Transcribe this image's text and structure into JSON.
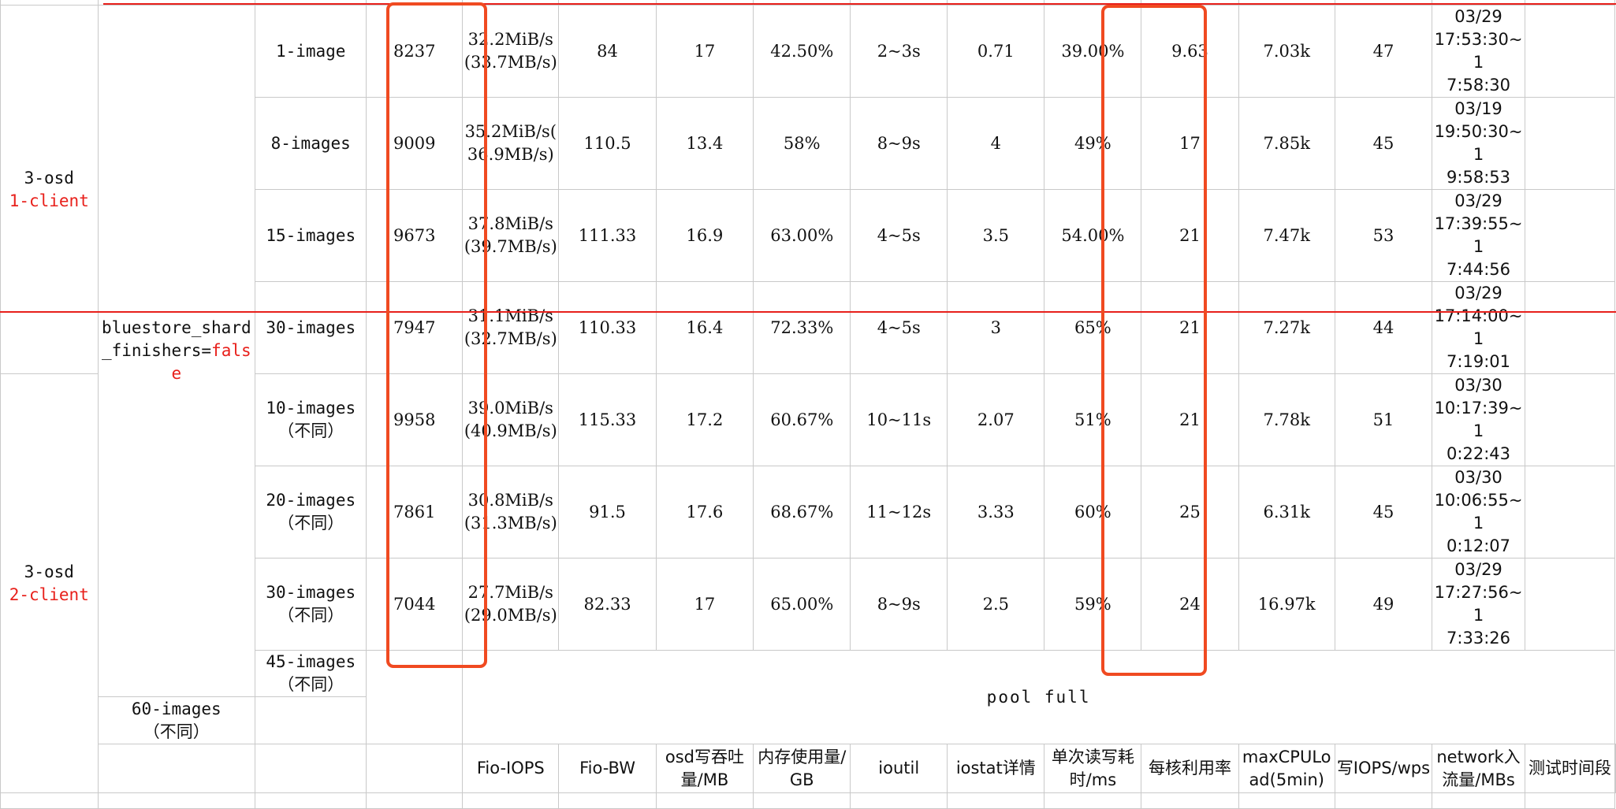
{
  "groups": [
    {
      "label": "3-osd",
      "client": "1-client"
    },
    {
      "label": "3-osd",
      "client": "2-client"
    }
  ],
  "config": {
    "key": "bluestore_shard_finishers=",
    "value": "false"
  },
  "rows": [
    {
      "image": "1-image",
      "sub": "",
      "iops": "8237",
      "bw1": "32.2MiB/s",
      "bw2": "(33.7MB/s)",
      "osd_tp": "84",
      "mem": "17",
      "ioutil": "42.50%",
      "iostat": "2~3s",
      "latency": "0.71",
      "core_util": "39.00%",
      "cpuload": "9.63",
      "wps": "7.03k",
      "network": "47",
      "time1": "03/29",
      "time2": "17:53:30~1",
      "time3": "7:58:30"
    },
    {
      "image": "8-images",
      "sub": "",
      "iops": "9009",
      "bw1": "35.2MiB/s(",
      "bw2": "36.9MB/s)",
      "osd_tp": "110.5",
      "mem": "13.4",
      "ioutil": "58%",
      "iostat": "8~9s",
      "latency": "4",
      "core_util": "49%",
      "cpuload": "17",
      "wps": "7.85k",
      "network": "45",
      "time1": "03/19",
      "time2": "19:50:30~1",
      "time3": "9:58:53"
    },
    {
      "image": "15-images",
      "sub": "",
      "iops": "9673",
      "bw1": "37.8MiB/s",
      "bw2": "(39.7MB/s)",
      "osd_tp": "111.33",
      "mem": "16.9",
      "ioutil": "63.00%",
      "iostat": "4~5s",
      "latency": "3.5",
      "core_util": "54.00%",
      "cpuload": "21",
      "wps": "7.47k",
      "network": "53",
      "time1": "03/29",
      "time2": "17:39:55~1",
      "time3": "7:44:56"
    },
    {
      "image": "30-images",
      "sub": "",
      "iops": "7947",
      "bw1": "31.1MiB/s",
      "bw2": "(32.7MB/s)",
      "osd_tp": "110.33",
      "mem": "16.4",
      "ioutil": "72.33%",
      "iostat": "4~5s",
      "latency": "3",
      "core_util": "65%",
      "cpuload": "21",
      "wps": "7.27k",
      "network": "44",
      "time1": "03/29",
      "time2": "17:14:00~1",
      "time3": "7:19:01"
    },
    {
      "image": "10-images",
      "sub": "（不同）",
      "iops": "9958",
      "bw1": "39.0MiB/s",
      "bw2": "(40.9MB/s)",
      "osd_tp": "115.33",
      "mem": "17.2",
      "ioutil": "60.67%",
      "iostat": "10~11s",
      "latency": "2.07",
      "core_util": "51%",
      "cpuload": "21",
      "wps": "7.78k",
      "network": "51",
      "time1": "03/30",
      "time2": "10:17:39~1",
      "time3": "0:22:43"
    },
    {
      "image": "20-images",
      "sub": "（不同）",
      "iops": "7861",
      "bw1": "30.8MiB/s",
      "bw2": "(31.3MB/s)",
      "osd_tp": "91.5",
      "mem": "17.6",
      "ioutil": "68.67%",
      "iostat": "11~12s",
      "latency": "3.33",
      "core_util": "60%",
      "cpuload": "25",
      "wps": "6.31k",
      "network": "45",
      "time1": "03/30",
      "time2": "10:06:55~1",
      "time3": "0:12:07"
    },
    {
      "image": "30-images",
      "sub": "（不同）",
      "iops": "7044",
      "bw1": "27.7MiB/s",
      "bw2": "(29.0MB/s)",
      "osd_tp": "82.33",
      "mem": "17",
      "ioutil": "65.00%",
      "iostat": "8~9s",
      "latency": "2.5",
      "core_util": "59%",
      "cpuload": "24",
      "wps": "16.97k",
      "network": "49",
      "time1": "03/29",
      "time2": "17:27:56~1",
      "time3": "7:33:26"
    }
  ],
  "pool_rows": [
    {
      "image": "45-images",
      "sub": "（不同）"
    },
    {
      "image": "60-images",
      "sub": "（不同）"
    }
  ],
  "pool_full": "pool full",
  "headers": {
    "iops": "Fio-IOPS",
    "bw": "Fio-BW",
    "osd_tp": "osd写吞吐量/MB",
    "mem": "内存使用量/GB",
    "ioutil": "ioutil",
    "iostat": "iostat详情",
    "latency": "单次读写耗时/ms",
    "core_util": "每核利用率",
    "cpuload": "maxCPULoad(5min)",
    "wps": "写IOPS/wps",
    "network": "network入流量/MBs",
    "time": "测试时间段"
  },
  "colors": {
    "accent_red": "#e8201b",
    "highlight": "#f04a21",
    "grid": "#c9c9c9"
  }
}
